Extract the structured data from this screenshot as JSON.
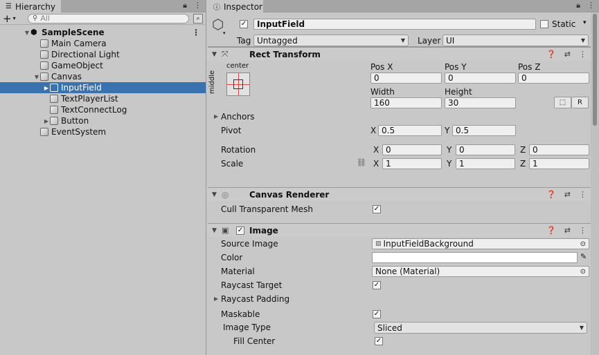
{
  "hierarchy": {
    "tab_label": "Hierarchy",
    "add_label": "+",
    "search_placeholder": "All",
    "items": [
      {
        "label": "SampleScene",
        "depth": 0,
        "expanded": true,
        "scene": true
      },
      {
        "label": "Main Camera",
        "depth": 1
      },
      {
        "label": "Directional Light",
        "depth": 1
      },
      {
        "label": "GameObject",
        "depth": 1
      },
      {
        "label": "Canvas",
        "depth": 1,
        "expanded": true
      },
      {
        "label": "InputField",
        "depth": 2,
        "selected": true,
        "collapsed": true
      },
      {
        "label": "TextPlayerList",
        "depth": 2
      },
      {
        "label": "TextConnectLog",
        "depth": 2
      },
      {
        "label": "Button",
        "depth": 2,
        "collapsed": true
      },
      {
        "label": "EventSystem",
        "depth": 1
      }
    ]
  },
  "inspector": {
    "tab_label": "Inspector",
    "object": {
      "name": "InputField",
      "active": true,
      "static_label": "Static",
      "tag_label": "Tag",
      "tag_value": "Untagged",
      "layer_label": "Layer",
      "layer_value": "UI"
    },
    "rect_transform": {
      "title": "Rect Transform",
      "anchor_top_label": "center",
      "anchor_side_label": "middle",
      "pos_x_label": "Pos X",
      "pos_x": "0",
      "pos_y_label": "Pos Y",
      "pos_y": "0",
      "pos_z_label": "Pos Z",
      "pos_z": "0",
      "width_label": "Width",
      "width": "160",
      "height_label": "Height",
      "height": "30",
      "r_button": "R",
      "anchors_label": "Anchors",
      "pivot_label": "Pivot",
      "pivot_x": "0.5",
      "pivot_y": "0.5",
      "rotation_label": "Rotation",
      "rot_x": "0",
      "rot_y": "0",
      "rot_z": "0",
      "scale_label": "Scale",
      "scale_x": "1",
      "scale_y": "1",
      "scale_z": "1",
      "x": "X",
      "y": "Y",
      "z": "Z"
    },
    "canvas_renderer": {
      "title": "Canvas Renderer",
      "cull_label": "Cull Transparent Mesh",
      "cull_value": true
    },
    "image": {
      "title": "Image",
      "enabled": true,
      "source_image_label": "Source Image",
      "source_image_value": "InputFieldBackground",
      "color_label": "Color",
      "material_label": "Material",
      "material_value": "None (Material)",
      "raycast_target_label": "Raycast Target",
      "raycast_padding_label": "Raycast Padding",
      "maskable_label": "Maskable",
      "image_type_label": "Image Type",
      "image_type_value": "Sliced",
      "fill_center_label": "Fill Center"
    }
  },
  "colors": {
    "panel_bg": "#c8c8c8",
    "selection": "#3a72b0",
    "field_bg": "#efefef"
  }
}
